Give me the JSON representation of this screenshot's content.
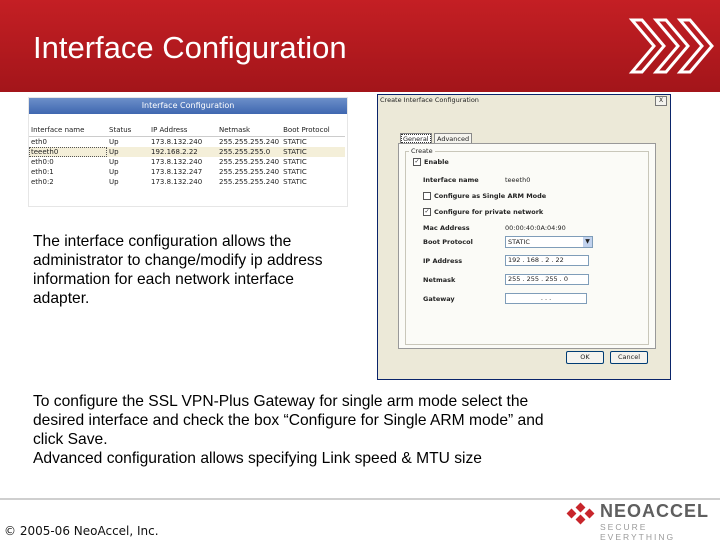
{
  "header": {
    "title": "Interface Configuration"
  },
  "table_shot": {
    "caption": "Interface Configuration",
    "columns": [
      "Interface name",
      "Status",
      "IP Address",
      "Netmask",
      "Boot Protocol"
    ],
    "rows": [
      [
        "eth0",
        "Up",
        "173.8.132.240",
        "255.255.255.240",
        "STATIC"
      ],
      [
        "teeeth0",
        "Up",
        "192.168.2.22",
        "255.255.255.0",
        "STATIC"
      ],
      [
        "eth0:0",
        "Up",
        "173.8.132.240",
        "255.255.255.240",
        "STATIC"
      ],
      [
        "eth0:1",
        "Up",
        "173.8.132.247",
        "255.255.255.240",
        "STATIC"
      ],
      [
        "eth0:2",
        "Up",
        "173.8.132.240",
        "255.255.255.240",
        "STATIC"
      ]
    ],
    "selected_row": 1
  },
  "dialog": {
    "title": "Create Interface Configuration",
    "close": "X",
    "tabs": [
      "General",
      "Advanced"
    ],
    "group_label": "Create",
    "enable_label": "Enable",
    "interface_name_label": "Interface name",
    "interface_name_value": "teeeth0",
    "single_arm_label": "Configure as Single ARM Mode",
    "private_network_label": "Configure for private network",
    "mac_label": "Mac Address",
    "mac_value": "00:00:40:0A:04:90",
    "boot_label": "Boot Protocol",
    "boot_value": "STATIC",
    "ip_label": "IP Address",
    "ip_value": "192 . 168 . 2 . 22",
    "netmask_label": "Netmask",
    "netmask_value": "255 . 255 . 255 . 0",
    "gateway_label": "Gateway",
    "gateway_value": ". . .",
    "ok_label": "OK",
    "cancel_label": "Cancel"
  },
  "text": {
    "para1": "The interface configuration allows the administrator to change/modify ip address information for each network interface adapter.",
    "para2_lines": [
      "To configure the SSL VPN-Plus Gateway for single arm mode select the",
      "desired interface and check the box “Configure for Single ARM mode” and",
      "click Save.",
      "Advanced configuration allows specifying Link speed & MTU size"
    ]
  },
  "footer": {
    "copyright": "© 2005-06 NeoAccel, Inc.",
    "brand": "NEOACCEL",
    "tagline": "SECURE EVERYTHING"
  },
  "colors": {
    "header_red": "#b51a1f",
    "dialog_bg": "#ece9d8",
    "table_caption_blue": "#4a71b6"
  }
}
